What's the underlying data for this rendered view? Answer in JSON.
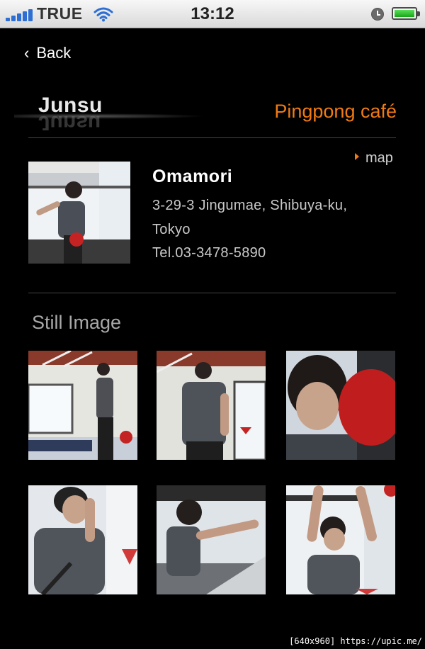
{
  "status_bar": {
    "carrier": "TRUE",
    "time": "13:12",
    "icons": [
      "signal-icon",
      "wifi-icon",
      "clock-icon",
      "battery-icon"
    ]
  },
  "nav": {
    "back_label": "Back",
    "back_icon": "chevron-left-icon"
  },
  "header": {
    "name": "Junsu",
    "venue_title": "Pingpong café"
  },
  "map_link": {
    "label": "map",
    "icon": "triangle-right-icon"
  },
  "place": {
    "name": "Omamori",
    "address_line1": "3-29-3 Jingumae, Shibuya-ku,",
    "address_line2": "Tokyo",
    "phone": "Tel.03-3478-5890"
  },
  "gallery": {
    "title": "Still Image",
    "images": [
      {
        "name": "still-image-1"
      },
      {
        "name": "still-image-2"
      },
      {
        "name": "still-image-3"
      },
      {
        "name": "still-image-4"
      },
      {
        "name": "still-image-5"
      },
      {
        "name": "still-image-6"
      }
    ]
  },
  "watermark": "[640x960] https://upic.me/",
  "colors": {
    "accent": "#f07a14",
    "background": "#000000"
  }
}
